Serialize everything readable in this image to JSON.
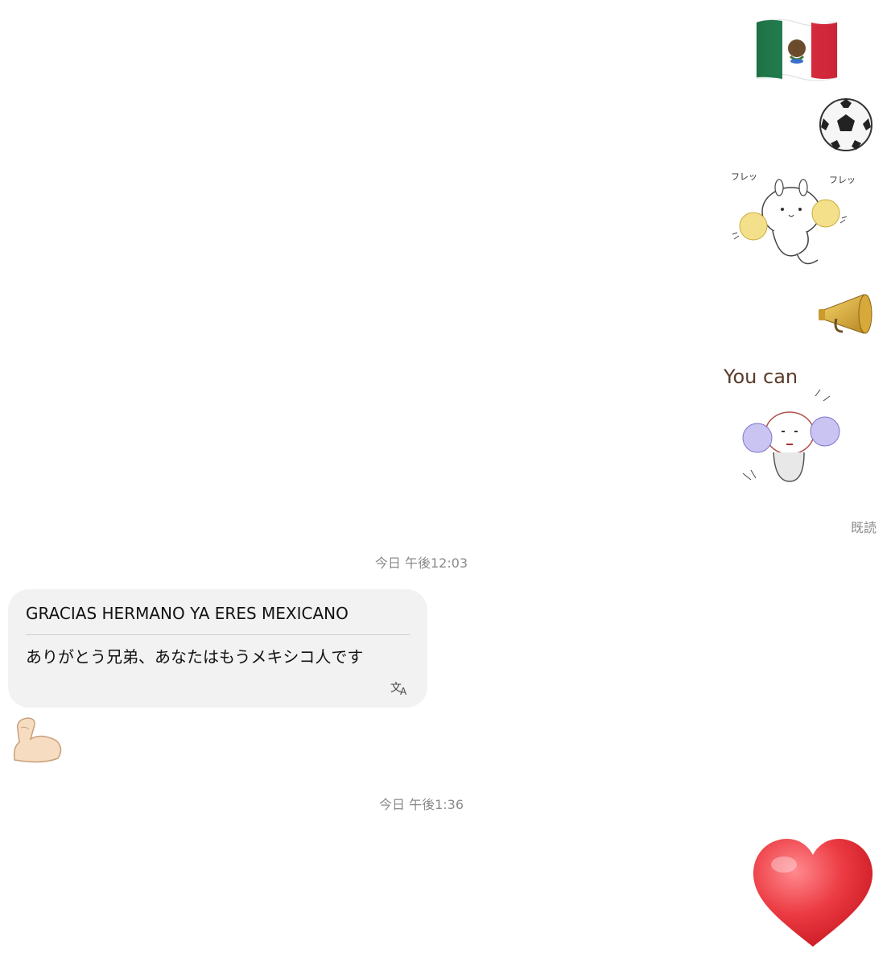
{
  "sent": {
    "flag_icon": "mexico-flag-icon",
    "ball_icon": "soccer-ball-icon",
    "sticker1": {
      "name": "cheering-rabbit-sticker",
      "text": "フレッ",
      "text2": "フレッ"
    },
    "megaphone_icon": "megaphone-icon",
    "sticker2": {
      "name": "you-can-sticker",
      "text": "You can"
    },
    "read_status": "既読"
  },
  "timestamps": {
    "first": "今日 午後12:03",
    "second": "今日 午後1:36"
  },
  "received": {
    "original": "GRACIAS HERMANO YA ERES MEXICANO",
    "translation": "ありがとう兄弟、あなたはもうメキシコ人です",
    "translate_icon": "translate-icon",
    "muscle_icon": "flexed-biceps-icon"
  },
  "final": {
    "heart_icon": "red-heart-icon"
  },
  "colors": {
    "bubble_bg": "#f2f2f2",
    "meta_text": "#8a8a8a",
    "heart": "#e5303a",
    "flag_green": "#1e7a4a",
    "flag_red": "#d7263a"
  }
}
